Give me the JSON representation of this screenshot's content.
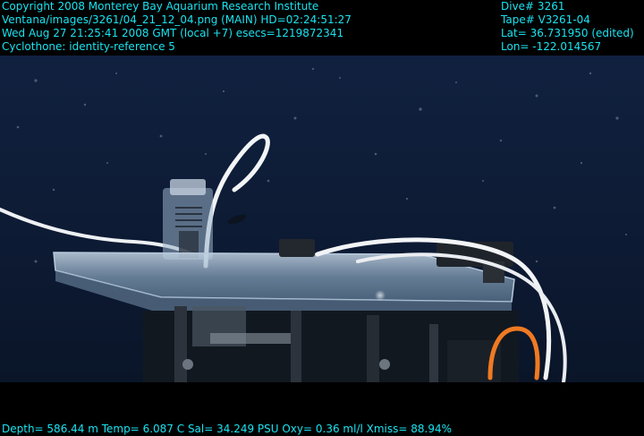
{
  "overlay": {
    "top_left": [
      "Copyright 2008 Monterey Bay Aquarium Research Institute",
      "Ventana/images/3261/04_21_12_04.png (MAIN)  HD=02:24:51:27",
      "Wed Aug 27 21:25:41 2008 GMT (local +7)  esecs=1219872341",
      "Cyclothone: identity-reference 5"
    ],
    "top_right": [
      "Dive# 3261",
      "Tape# V3261-04",
      "Lat= 36.731950 (edited)",
      "Lon= -122.014567"
    ],
    "bottom": "Depth= 586.44 m  Temp= 6.087 C  Sal= 34.249 PSU  Oxy= 0.36 ml/l  Xmiss= 88.94%"
  },
  "colors": {
    "overlay_text": "#19e3f0",
    "water_top": "#10213f",
    "water_bottom": "#0a1528",
    "letterbox": "#000000",
    "tube_white": "#f2f4f6",
    "tube_orange": "#f07a22",
    "acrylic": "#9fb8d0"
  }
}
